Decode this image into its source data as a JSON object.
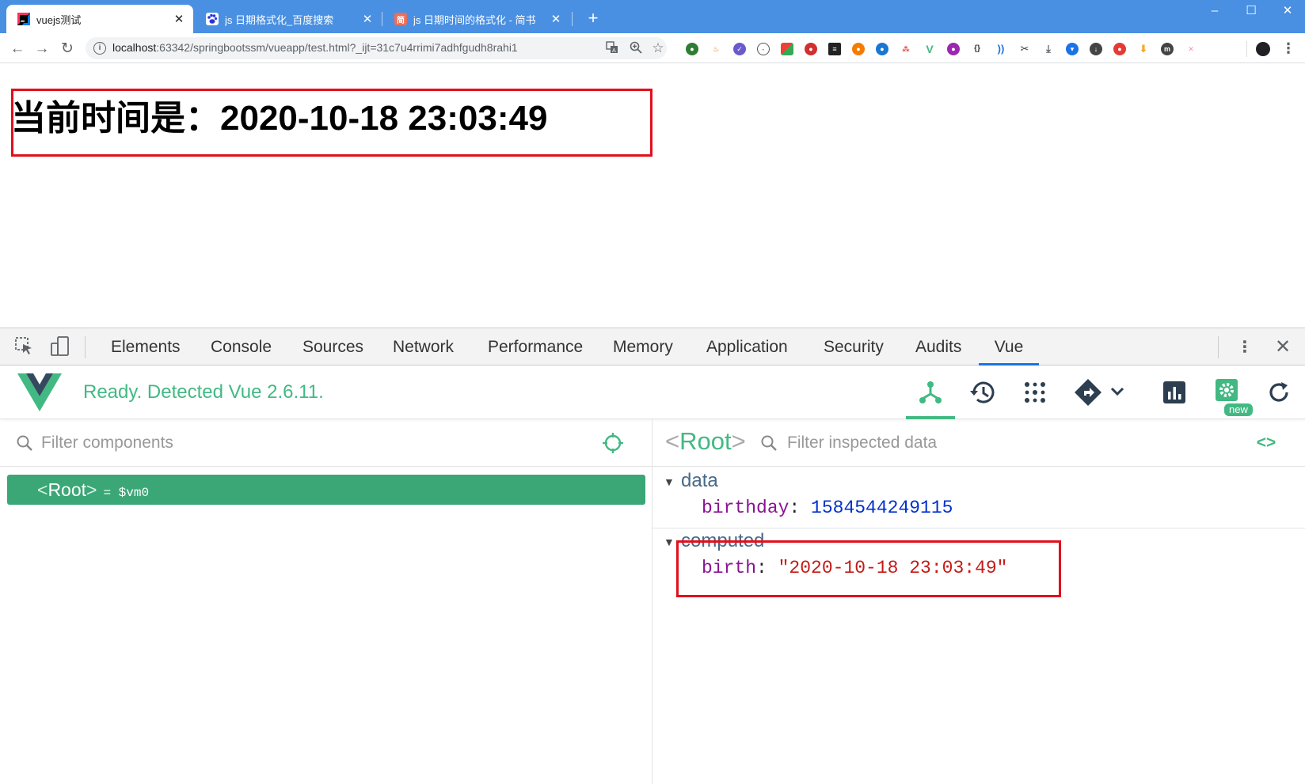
{
  "browser": {
    "tabs": [
      {
        "title": "vuejs测试",
        "favicon": "idea-icon",
        "active": true
      },
      {
        "title": "js 日期格式化_百度搜索",
        "favicon": "baidu-paw-icon",
        "active": false
      },
      {
        "title": "js 日期时间的格式化 - 简书",
        "favicon": "jianshu-icon",
        "active": false
      }
    ],
    "favicon_jianshu_char": "简",
    "new_tab_symbol": "+",
    "window_controls": [
      "–",
      "☐",
      "✕"
    ],
    "url_host": "localhost",
    "url_rest": ":63342/springbootssm/vueapp/test.html?_ijt=31c7u4rrimi7adhfgudh8rahi1",
    "info_symbol": "i"
  },
  "page": {
    "heading": "当前时间是：2020-10-18 23:03:49"
  },
  "devtools": {
    "tabs": [
      "Elements",
      "Console",
      "Sources",
      "Network",
      "Performance",
      "Memory",
      "Application",
      "Security",
      "Audits",
      "Vue"
    ],
    "active_tab": "Vue",
    "close_symbol": "✕"
  },
  "vue": {
    "status": "Ready. Detected Vue 2.6.11.",
    "new_badge": "new",
    "filter_components_placeholder": "Filter components",
    "filter_data_placeholder": "Filter inspected data",
    "root_row": {
      "name": "Root",
      "vm": "= $vm0"
    },
    "inspected_title": "Root",
    "sections": [
      {
        "title": "data",
        "props": [
          {
            "key": "birthday",
            "value": "1584544249115",
            "type": "number"
          }
        ]
      },
      {
        "title": "computed",
        "props": [
          {
            "key": "birth",
            "value": "\"2020-10-18 23:03:49\"",
            "type": "string"
          }
        ]
      }
    ],
    "accent_color": "#42b983"
  },
  "colors": {
    "tabstrip": "#4a90e2",
    "highlight_box": "#e0101c",
    "selected_row": "#3ba776"
  }
}
